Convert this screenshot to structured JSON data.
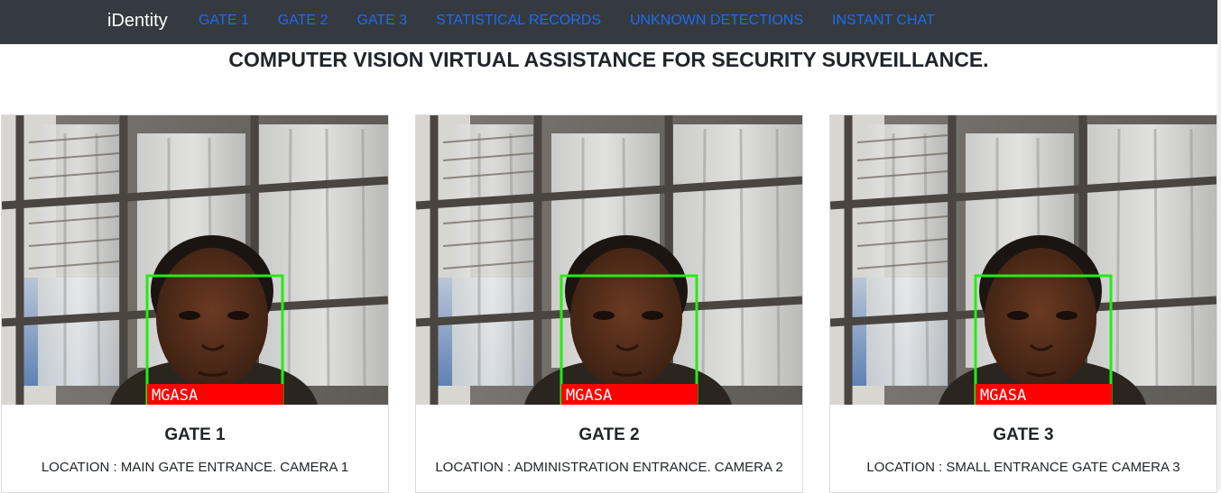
{
  "navbar": {
    "brand": "iDentity",
    "links": [
      "GATE 1",
      "GATE 2",
      "GATE 3",
      "STATISTICAL RECORDS",
      "UNKNOWN DETECTIONS",
      "INSTANT CHAT"
    ]
  },
  "page_title": "COMPUTER VISION VIRTUAL ASSISTANCE FOR SECURITY SURVEILLANCE.",
  "cards": [
    {
      "title": "GATE 1",
      "location": "LOCATION : MAIN GATE ENTRANCE. CAMERA 1",
      "detection_label": "MGASA"
    },
    {
      "title": "GATE 2",
      "location": "LOCATION : ADMINISTRATION ENTRANCE. CAMERA 2",
      "detection_label": "MGASA"
    },
    {
      "title": "GATE 3",
      "location": "LOCATION : SMALL ENTRANCE GATE CAMERA 3",
      "detection_label": "MGASA"
    }
  ],
  "colors": {
    "navbar_bg": "#343a40",
    "nav_link": "#1e6bf0",
    "detection_box": "#22ee11",
    "detection_label_bg": "#ff0000"
  }
}
